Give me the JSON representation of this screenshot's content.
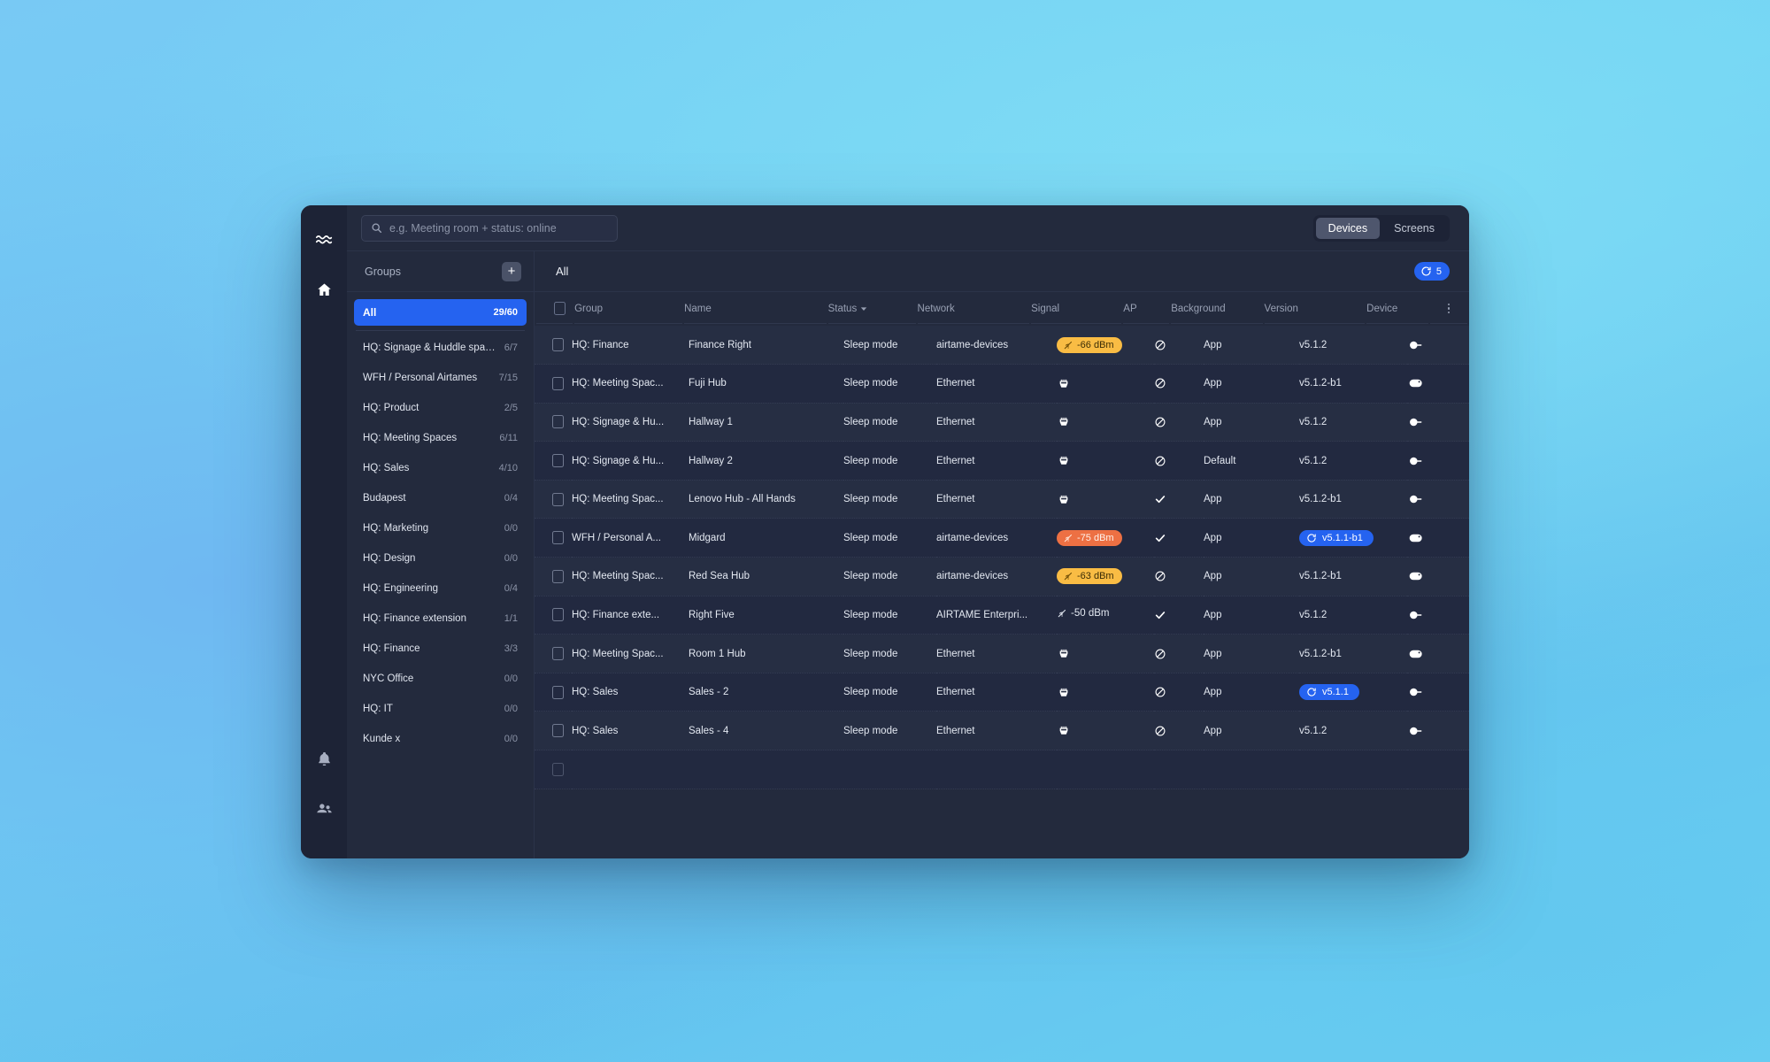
{
  "rail": {
    "items": [
      {
        "name": "airtame-logo-icon",
        "label": "Airtame"
      },
      {
        "name": "home-icon",
        "label": "Home"
      },
      {
        "name": "bell-icon",
        "label": "Notifications"
      },
      {
        "name": "people-icon",
        "label": "Users"
      }
    ]
  },
  "topbar": {
    "search": {
      "placeholder": "e.g. Meeting room + status: online",
      "value": "",
      "icon": "search-icon"
    },
    "view_toggle": {
      "options": [
        "Devices",
        "Screens"
      ],
      "active": "Devices"
    }
  },
  "sidebar": {
    "title": "Groups",
    "add_button_label": "+",
    "items": [
      {
        "label": "All",
        "count": "29/60",
        "active": true
      },
      {
        "label": "HQ: Signage & Huddle spaces",
        "count": "6/7",
        "active": false
      },
      {
        "label": "WFH / Personal Airtames",
        "count": "7/15",
        "active": false
      },
      {
        "label": "HQ: Product",
        "count": "2/5",
        "active": false
      },
      {
        "label": "HQ: Meeting Spaces",
        "count": "6/11",
        "active": false
      },
      {
        "label": "HQ: Sales",
        "count": "4/10",
        "active": false
      },
      {
        "label": "Budapest",
        "count": "0/4",
        "active": false
      },
      {
        "label": "HQ: Marketing",
        "count": "0/0",
        "active": false
      },
      {
        "label": "HQ: Design",
        "count": "0/0",
        "active": false
      },
      {
        "label": "HQ: Engineering",
        "count": "0/4",
        "active": false
      },
      {
        "label": "HQ: Finance extension",
        "count": "1/1",
        "active": false
      },
      {
        "label": "HQ: Finance",
        "count": "3/3",
        "active": false
      },
      {
        "label": "NYC Office",
        "count": "0/0",
        "active": false
      },
      {
        "label": "HQ: IT",
        "count": "0/0",
        "active": false
      },
      {
        "label": "Kunde x",
        "count": "0/0",
        "active": false
      }
    ]
  },
  "main": {
    "title": "All",
    "update_pill": {
      "count": "5",
      "icon": "update-clock-icon"
    },
    "columns": [
      {
        "key": "checkbox",
        "label": ""
      },
      {
        "key": "group",
        "label": "Group"
      },
      {
        "key": "name",
        "label": "Name"
      },
      {
        "key": "status",
        "label": "Status",
        "sorted": true,
        "sort_dir": "desc"
      },
      {
        "key": "network",
        "label": "Network"
      },
      {
        "key": "signal",
        "label": "Signal"
      },
      {
        "key": "ap",
        "label": "AP"
      },
      {
        "key": "background",
        "label": "Background"
      },
      {
        "key": "version",
        "label": "Version"
      },
      {
        "key": "device",
        "label": "Device"
      },
      {
        "key": "menu",
        "label": ""
      }
    ],
    "rows": [
      {
        "checked": false,
        "group": "HQ: Finance",
        "name": "Finance Right",
        "status": "Sleep mode",
        "network": "airtame-devices",
        "signal": {
          "kind": "badge-amber",
          "text": "-66 dBm",
          "icon": "wifi-icon"
        },
        "ap": "blocked",
        "background": "App",
        "version": {
          "kind": "text",
          "text": "v5.1.2"
        },
        "device": "dongle",
        "menu": "gear-icon"
      },
      {
        "checked": false,
        "group": "HQ: Meeting Spac...",
        "name": "Fuji Hub",
        "status": "Sleep mode",
        "network": "Ethernet",
        "signal": {
          "kind": "ethernet",
          "text": "",
          "icon": "ethernet-port-icon"
        },
        "ap": "blocked",
        "background": "App",
        "version": {
          "kind": "text",
          "text": "v5.1.2-b1"
        },
        "device": "hub",
        "menu": "gear-icon"
      },
      {
        "checked": false,
        "group": "HQ: Signage & Hu...",
        "name": "Hallway 1",
        "status": "Sleep mode",
        "network": "Ethernet",
        "signal": {
          "kind": "ethernet",
          "text": "",
          "icon": "ethernet-port-icon"
        },
        "ap": "blocked",
        "background": "App",
        "version": {
          "kind": "text",
          "text": "v5.1.2"
        },
        "device": "dongle",
        "menu": "gear-icon"
      },
      {
        "checked": false,
        "group": "HQ: Signage & Hu...",
        "name": "Hallway 2",
        "status": "Sleep mode",
        "network": "Ethernet",
        "signal": {
          "kind": "ethernet",
          "text": "",
          "icon": "ethernet-port-icon"
        },
        "ap": "blocked",
        "background": "Default",
        "version": {
          "kind": "text",
          "text": "v5.1.2"
        },
        "device": "dongle",
        "menu": "gear-icon"
      },
      {
        "checked": false,
        "group": "HQ: Meeting Spac...",
        "name": "Lenovo Hub - All Hands",
        "status": "Sleep mode",
        "network": "Ethernet",
        "signal": {
          "kind": "ethernet",
          "text": "",
          "icon": "ethernet-port-icon"
        },
        "ap": "allowed",
        "background": "App",
        "version": {
          "kind": "text",
          "text": "v5.1.2-b1"
        },
        "device": "dongle",
        "menu": "gear-icon"
      },
      {
        "checked": false,
        "group": "WFH / Personal A...",
        "name": "Midgard",
        "status": "Sleep mode",
        "network": "airtame-devices",
        "signal": {
          "kind": "badge-orange",
          "text": "-75 dBm",
          "icon": "wifi-icon"
        },
        "ap": "allowed",
        "background": "App",
        "version": {
          "kind": "pill",
          "text": "v5.1.1-b1",
          "icon": "update-clock-icon"
        },
        "device": "hub",
        "menu": "gear-icon"
      },
      {
        "checked": false,
        "group": "HQ: Meeting Spac...",
        "name": "Red Sea Hub",
        "status": "Sleep mode",
        "network": "airtame-devices",
        "signal": {
          "kind": "badge-amber",
          "text": "-63 dBm",
          "icon": "wifi-icon"
        },
        "ap": "blocked",
        "background": "App",
        "version": {
          "kind": "text",
          "text": "v5.1.2-b1"
        },
        "device": "hub",
        "menu": "gear-icon"
      },
      {
        "checked": false,
        "group": "HQ: Finance exte...",
        "name": "Right Five",
        "status": "Sleep mode",
        "network": "AIRTAME Enterpri...",
        "signal": {
          "kind": "plain",
          "text": "-50 dBm",
          "icon": "wifi-icon"
        },
        "ap": "allowed",
        "background": "App",
        "version": {
          "kind": "text",
          "text": "v5.1.2"
        },
        "device": "dongle",
        "menu": "gear-icon"
      },
      {
        "checked": false,
        "group": "HQ: Meeting Spac...",
        "name": "Room 1 Hub",
        "status": "Sleep mode",
        "network": "Ethernet",
        "signal": {
          "kind": "ethernet",
          "text": "",
          "icon": "ethernet-port-icon"
        },
        "ap": "blocked",
        "background": "App",
        "version": {
          "kind": "text",
          "text": "v5.1.2-b1"
        },
        "device": "hub",
        "menu": "gear-icon"
      },
      {
        "checked": false,
        "group": "HQ: Sales",
        "name": "Sales - 2",
        "status": "Sleep mode",
        "network": "Ethernet",
        "signal": {
          "kind": "ethernet",
          "text": "",
          "icon": "ethernet-port-icon"
        },
        "ap": "blocked",
        "background": "App",
        "version": {
          "kind": "pill",
          "text": "v5.1.1",
          "icon": "update-clock-icon"
        },
        "device": "dongle",
        "menu": "gear-icon"
      },
      {
        "checked": false,
        "group": "HQ: Sales",
        "name": "Sales - 4",
        "status": "Sleep mode",
        "network": "Ethernet",
        "signal": {
          "kind": "ethernet",
          "text": "",
          "icon": "ethernet-port-icon"
        },
        "ap": "blocked",
        "background": "App",
        "version": {
          "kind": "text",
          "text": "v5.1.2"
        },
        "device": "dongle",
        "menu": "gear-icon"
      },
      {
        "checked": false,
        "group": "",
        "name": "",
        "status": "",
        "network": "",
        "signal": {
          "kind": "none",
          "text": "",
          "icon": ""
        },
        "ap": "none",
        "background": "",
        "version": {
          "kind": "text",
          "text": ""
        },
        "device": "none",
        "menu": "gear-icon"
      }
    ]
  },
  "colors": {
    "accent_blue": "#2563f0",
    "panel_bg": "#232a3d",
    "rail_bg": "#1d2336",
    "row_odd": "#262e43",
    "row_even": "#222940",
    "signal_amber": "#f9bc44",
    "signal_orange": "#ed7043",
    "text_primary": "#e3e8f1",
    "text_muted": "#98a0b3"
  }
}
